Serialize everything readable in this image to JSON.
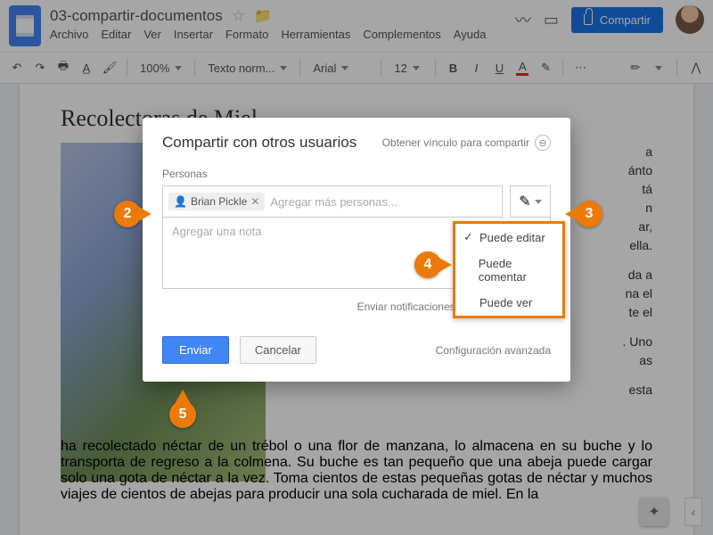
{
  "header": {
    "doc_title": "03-compartir-documentos",
    "menu": [
      "Archivo",
      "Editar",
      "Ver",
      "Insertar",
      "Formato",
      "Herramientas",
      "Complementos",
      "Ayuda"
    ],
    "share_label": "Compartir"
  },
  "toolbar": {
    "zoom": "100%",
    "style": "Texto norm...",
    "font": "Arial",
    "size": "12"
  },
  "document": {
    "heading": "Recolectoras de Miel",
    "p1_a": "a",
    "p1_b": "ánto",
    "p1_c": "tá",
    "p1_d": "n",
    "p1_e": "ar,",
    "p1_f": "ella.",
    "p2_a": "da a",
    "p2_b": "na el",
    "p2_c": "te el",
    "p3_a": ". Uno",
    "p3_b": "as",
    "p4_a": "esta",
    "p4": "ha recolectado néctar de un trébol o una flor de manzana, lo almacena en su buche y lo transporta de regreso a la colmena. Su buche es tan pequeño que una abeja puede cargar solo una gota de néctar a la vez. Toma cientos de estas pequeñas gotas de néctar y muchos viajes de cientos de abejas para producir una sola cucharada de miel. En la"
  },
  "share_modal": {
    "title": "Compartir con otros usuarios",
    "get_link": "Obtener vínculo para compartir",
    "people_label": "Personas",
    "chip_name": "Brian Pickle",
    "people_placeholder": "Agregar más personas...",
    "note_placeholder": "Agregar una nota",
    "perm_options": [
      "Puede editar",
      "Puede comentar",
      "Puede ver"
    ],
    "perm_selected_index": 0,
    "notify_label": "Enviar notificaciones a las personas",
    "notify_checked": true,
    "send": "Enviar",
    "cancel": "Cancelar",
    "advanced": "Configuración avanzada"
  },
  "callouts": {
    "c2": "2",
    "c3": "3",
    "c4": "4",
    "c5": "5"
  }
}
